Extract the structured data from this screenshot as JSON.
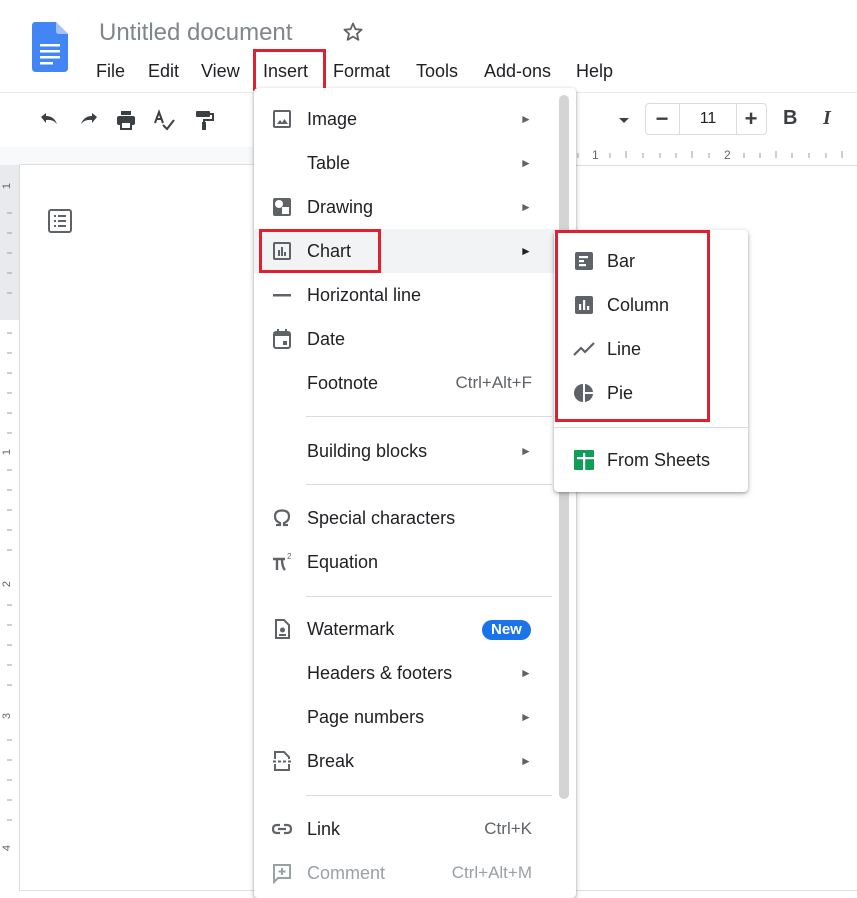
{
  "app": {
    "doc_title": "Untitled document"
  },
  "menubar": {
    "items": [
      "File",
      "Edit",
      "View",
      "Insert",
      "Format",
      "Tools",
      "Add-ons",
      "Help"
    ]
  },
  "toolbar": {
    "font_size": "11",
    "decrease_label": "−",
    "increase_label": "+",
    "bold_label": "B",
    "italic_label": "I"
  },
  "ruler": {
    "h_marks": [
      "1",
      "2"
    ],
    "v_marks": [
      "1",
      "1",
      "2",
      "3",
      "4"
    ]
  },
  "insert_menu": {
    "items": [
      {
        "label": "Image",
        "icon": "image-icon",
        "submenu": true
      },
      {
        "label": "Table",
        "icon": "",
        "submenu": true
      },
      {
        "label": "Drawing",
        "icon": "drawing-icon",
        "submenu": true
      },
      {
        "label": "Chart",
        "icon": "chart-icon",
        "submenu": true
      },
      {
        "label": "Horizontal line",
        "icon": "horizontal-line-icon",
        "submenu": false
      },
      {
        "label": "Date",
        "icon": "calendar-icon",
        "submenu": false
      },
      {
        "label": "Footnote",
        "icon": "",
        "shortcut": "Ctrl+Alt+F"
      },
      {
        "label": "Building blocks",
        "icon": "",
        "submenu": true
      },
      {
        "label": "Special characters",
        "icon": "omega-icon",
        "submenu": false
      },
      {
        "label": "Equation",
        "icon": "pi-icon",
        "submenu": false
      },
      {
        "label": "Watermark",
        "icon": "watermark-icon",
        "badge": "New"
      },
      {
        "label": "Headers & footers",
        "icon": "",
        "submenu": true
      },
      {
        "label": "Page numbers",
        "icon": "",
        "submenu": true
      },
      {
        "label": "Break",
        "icon": "break-icon",
        "submenu": true
      },
      {
        "label": "Link",
        "icon": "link-icon",
        "shortcut": "Ctrl+K"
      },
      {
        "label": "Comment",
        "icon": "comment-icon",
        "shortcut": "Ctrl+Alt+M",
        "disabled": true
      }
    ],
    "arrow": "►"
  },
  "chart_submenu": {
    "items": [
      {
        "label": "Bar",
        "icon": "bar-chart-icon"
      },
      {
        "label": "Column",
        "icon": "column-chart-icon"
      },
      {
        "label": "Line",
        "icon": "line-chart-icon"
      },
      {
        "label": "Pie",
        "icon": "pie-chart-icon"
      },
      {
        "label": "From Sheets",
        "icon": "sheets-icon"
      }
    ]
  },
  "colors": {
    "highlight_border": "#e0202e",
    "badge_blue": "#1a73e8",
    "docs_blue": "#4285f4",
    "sheets_green": "#0f9d58"
  }
}
